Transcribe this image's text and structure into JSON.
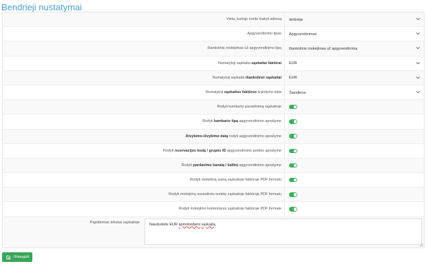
{
  "page": {
    "title": "Bendrieji nustatymai"
  },
  "settings": [
    {
      "type": "select",
      "label_parts": [
        {
          "t": "Vieta, kurioje norite matyti adresą",
          "b": false
        }
      ],
      "value": "dešinėje"
    },
    {
      "type": "select",
      "label_parts": [
        {
          "t": "Apgyvendinimo tipas",
          "b": false
        }
      ],
      "value": "Apgyvendinimas"
    },
    {
      "type": "select",
      "label_parts": [
        {
          "t": "Išankstinis mokėjimas už apgyvendinimo tipą",
          "b": false
        }
      ],
      "value": "Išankstinis mokėjimas už apgyvendinimą"
    },
    {
      "type": "select",
      "label_parts": [
        {
          "t": "Numatytoji sąskaita ",
          "b": false
        },
        {
          "t": "sąskaitai faktūrai",
          "b": true
        }
      ],
      "value": "EUR"
    },
    {
      "type": "select",
      "label_parts": [
        {
          "t": "Numatytoji sąskaita ",
          "b": false
        },
        {
          "t": "išankstinei sąskaitai",
          "b": true
        }
      ],
      "value": "EUR"
    },
    {
      "type": "select",
      "label_parts": [
        {
          "t": "Numatytoji ",
          "b": false
        },
        {
          "t": "sąskaitos faktūros",
          "b": true
        },
        {
          "t": " įvykdymo data",
          "b": false
        }
      ],
      "value": "Šiandiena"
    },
    {
      "type": "toggle",
      "label_parts": [
        {
          "t": "Rodyti kambario pavadinimą sąskaitoje",
          "b": false
        }
      ],
      "on": true
    },
    {
      "type": "toggle",
      "label_parts": [
        {
          "t": "Rodyti ",
          "b": false
        },
        {
          "t": "kambario tipą",
          "b": true
        },
        {
          "t": " apgyvendinimo aprašyme",
          "b": false
        }
      ],
      "on": true
    },
    {
      "type": "toggle",
      "label_parts": [
        {
          "t": "Atvykimo-išvykimo datą",
          "b": true
        },
        {
          "t": " rodyti apgyvendinimo aprašyme",
          "b": false
        }
      ],
      "on": true
    },
    {
      "type": "toggle",
      "label_parts": [
        {
          "t": "Rodyti ",
          "b": false
        },
        {
          "t": "rezervacijos kodą / grupės ID",
          "b": true
        },
        {
          "t": " apgyvendinimo prekės aprašyme",
          "b": false
        }
      ],
      "on": true
    },
    {
      "type": "toggle",
      "label_parts": [
        {
          "t": "Rodyti ",
          "b": false
        },
        {
          "t": "pardavimo kanalą / šaltinį",
          "b": true
        },
        {
          "t": " apgyvendinimo aprašyme",
          "b": false
        }
      ],
      "on": true
    },
    {
      "type": "toggle",
      "label_parts": [
        {
          "t": "Rodyti mokėtiną sumą sąskaitoje faktūroje PDF formatu",
          "b": false
        }
      ],
      "on": true
    },
    {
      "type": "toggle",
      "label_parts": [
        {
          "t": "Rodyti mokėjimų suvestinės lentelę sąskaitoje faktūroje PDF formatu",
          "b": false
        }
      ],
      "on": true
    },
    {
      "type": "toggle",
      "label_parts": [
        {
          "t": "Rodyti mokėjimo komentarus sąskaitoje faktūroje PDF formate",
          "b": false
        }
      ],
      "on": true
    }
  ],
  "extra_text": {
    "label": "Papildomas tekstas sąskaitoje",
    "value_parts": [
      {
        "t": "Nauduokite EUR ",
        "u": false
      },
      {
        "t": "apmokėdami",
        "u": true
      },
      {
        "t": " ",
        "u": false
      },
      {
        "t": "sąskaitą",
        "u": true
      },
      {
        "t": ".",
        "u": false
      }
    ]
  },
  "save_button": {
    "label": "Išsaugoti"
  },
  "colors": {
    "accent": "#4a9fd5",
    "toggle_on": "#3fae5f",
    "save": "#3aa55a"
  },
  "icons": {
    "select": "chevron-down-icon",
    "save": "save-icon",
    "resize": "resize-grip-icon"
  }
}
